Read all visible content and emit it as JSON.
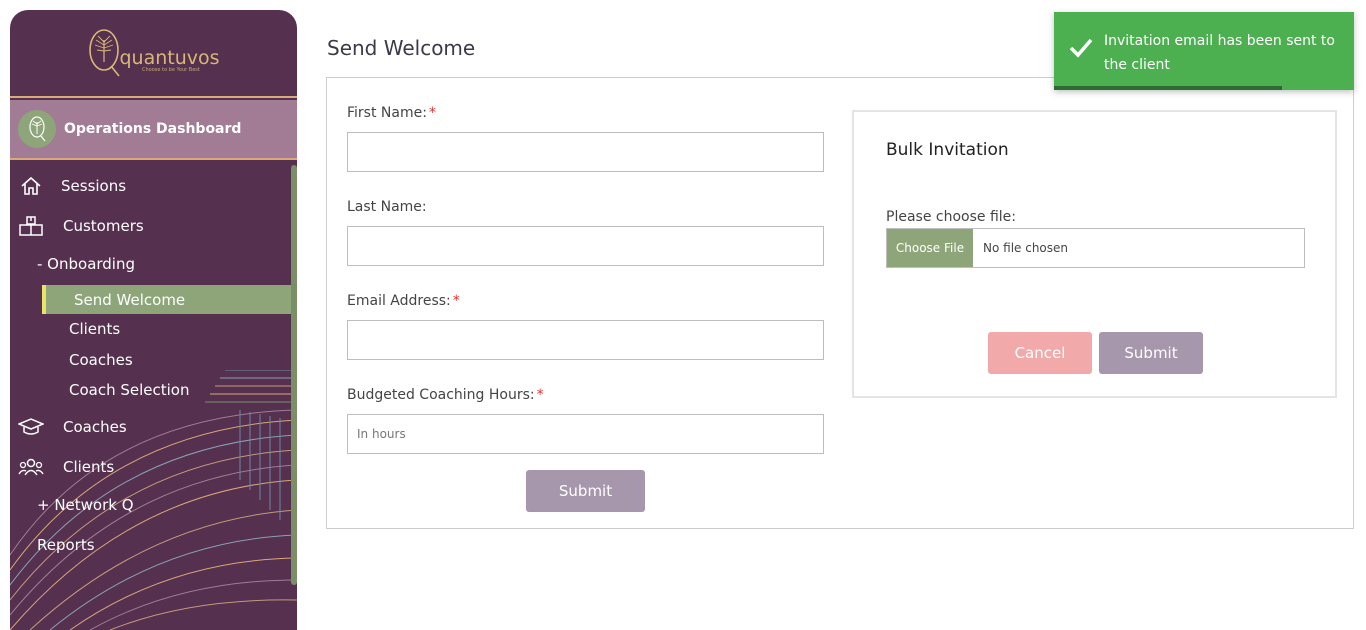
{
  "sidebar": {
    "logo_text": "quantuvos",
    "logo_tagline": "Choose to be Your Best",
    "dashboard_title": "Operations Dashboard",
    "items": {
      "sessions": "Sessions",
      "customers": "Customers",
      "onboarding": "- Onboarding",
      "send_welcome": "Send Welcome",
      "clients_sub": "Clients",
      "coaches_sub": "Coaches",
      "coach_selection": "Coach Selection",
      "coaches": "Coaches",
      "clients": "Clients",
      "network_q": "+ Network Q",
      "reports": "Reports"
    },
    "accent": "#8ea57a",
    "background": "#55304f"
  },
  "page": {
    "title": "Send Welcome"
  },
  "form": {
    "first_name_label": "First Name:",
    "last_name_label": "Last Name:",
    "email_label": "Email Address:",
    "hours_label": "Budgeted Coaching Hours:",
    "required_mark": "*",
    "first_name_value": "",
    "last_name_value": "",
    "email_value": "",
    "hours_placeholder": "In hours",
    "submit_label": "Submit"
  },
  "bulk": {
    "title": "Bulk Invitation",
    "file_label": "Please choose file:",
    "choose_file_label": "Choose File",
    "file_status": "No file chosen",
    "cancel_label": "Cancel",
    "submit_label": "Submit"
  },
  "toast": {
    "message": "Invitation email has been sent to the client",
    "progress": 0.76,
    "color": "#4caf50"
  }
}
